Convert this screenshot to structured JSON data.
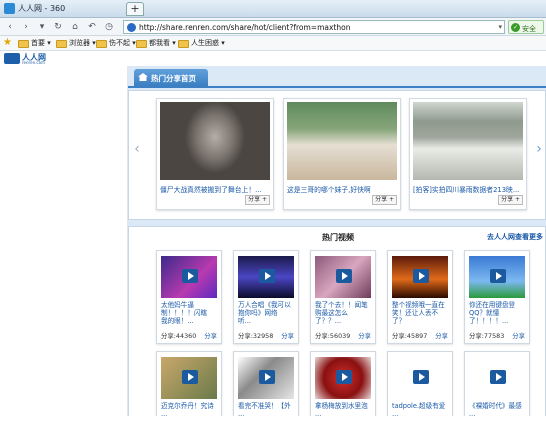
{
  "window": {
    "title": "人人网 - 360",
    "new_tab_label": "+"
  },
  "nav": {
    "back": "‹",
    "forward": "›",
    "refresh": "↻",
    "home": "⌂",
    "undo": "↶",
    "history": "◷",
    "url": "http://share.renren.com/share/hot/client?from=maxthon",
    "dropdown": "▾",
    "secure_label": "安全"
  },
  "bookmarks": {
    "items": [
      {
        "label": "首要 ▾"
      },
      {
        "label": "浏览器 ▾"
      },
      {
        "label": "伤不起 ▾"
      },
      {
        "label": "都我看 ▾"
      },
      {
        "label": "人生困惑 ▾"
      }
    ]
  },
  "site": {
    "logo_name": "人人网",
    "logo_domain": "renren.com"
  },
  "main": {
    "home_tab": "热门分享首页",
    "share_left_arrow": "‹",
    "share_right_arrow": "›",
    "shares": [
      {
        "caption": "僵尸大战真然被搬到了舞台上！...",
        "share": "分享 +"
      },
      {
        "caption": "这是三哥的哪个妹子,好快啊",
        "share": "分享 +"
      },
      {
        "caption": "[拍客]实拍四川暴雨数据者213映...",
        "share": "分享 +"
      }
    ],
    "video_header": "热门视频",
    "video_more": "去人人网查看更多",
    "videos": [
      {
        "title": "太他妈牛逼\n制！！！！闪瞎\n我的眼！...",
        "count": "分享:44360",
        "share": "分享"
      },
      {
        "title": "万人合唱《我可以\n抱你吗》网络\n听...",
        "count": "分享:32958",
        "share": "分享"
      },
      {
        "title": "我了个去！！闻笔\n购最这怎么\n了？？...",
        "count": "分享:56039",
        "share": "分享"
      },
      {
        "title": "整个视频哦一直在\n笑！还让人丢不\n了？",
        "count": "分享:45897",
        "share": "分享"
      },
      {
        "title": "你还在用键盘登\nQQ？就懂\n了！！！！...",
        "count": "分享:77583",
        "share": "分享"
      },
      {
        "title": "迈克尔乔丹！究诗\n...",
        "count": "",
        "share": ""
      },
      {
        "title": "看完不准哭！【外\n...",
        "count": "",
        "share": ""
      },
      {
        "title": "拿杨梅放到水里泡\n...",
        "count": "",
        "share": ""
      },
      {
        "title": "tadpole.超级有爱\n...",
        "count": "",
        "share": ""
      },
      {
        "title": "《裸婚时代》最感\n...",
        "count": "",
        "share": ""
      }
    ]
  }
}
